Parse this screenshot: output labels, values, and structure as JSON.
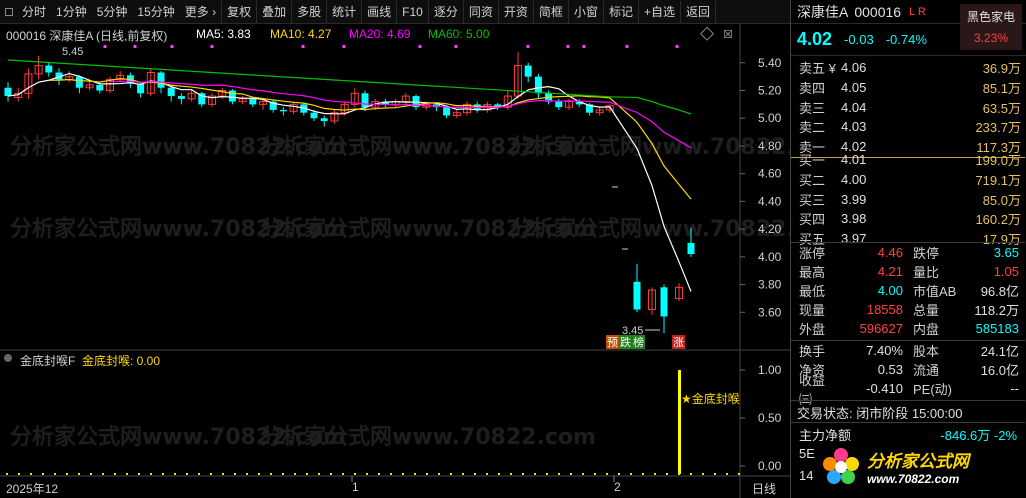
{
  "toolbar": {
    "items": [
      "分时",
      "1分钟",
      "5分钟",
      "15分钟",
      "更多 ›",
      "复权",
      "叠加",
      "多股",
      "统计",
      "画线",
      "F10",
      "逐分",
      "同资",
      "开资",
      "简框",
      "小窗",
      "标记",
      "+自选",
      "返回"
    ]
  },
  "main_header": {
    "code_name": "000016 深康佳A (日线,前复权)",
    "ma5": "MA5: 3.83",
    "ma10": "MA10: 4.27",
    "ma20": "MA20: 4.69",
    "ma60": "MA60: 5.00",
    "high_marker": "5.45",
    "low_marker": "3.45"
  },
  "badges": [
    "预",
    "跌",
    "榜",
    "涨"
  ],
  "sub_header": {
    "name": "金底封喉F",
    "value": "金底封喉: 0.00"
  },
  "signal_label": "★金底封喉",
  "x_axis": [
    "2025年12",
    "1",
    "2",
    "日线"
  ],
  "watermark": "分析家公式网www.70822.com",
  "colors": {
    "up": "#ff3c3c",
    "down": "#00ffff",
    "ma5": "#ffffff",
    "ma10": "#ffd700",
    "ma20": "#ff00ff",
    "ma60": "#00c000"
  },
  "chart_data": {
    "type": "candlestick",
    "ylim": [
      3.4,
      5.55
    ],
    "y_ticks": [
      5.4,
      5.2,
      5.0,
      4.8,
      4.6,
      4.4,
      4.2,
      4.0,
      3.8,
      3.6
    ],
    "sub_y_ticks": [
      1.0,
      0.5,
      0.0
    ],
    "candles": [
      [
        5.22,
        5.16,
        5.26,
        5.12
      ],
      [
        5.15,
        5.18,
        5.22,
        5.12
      ],
      [
        5.18,
        5.32,
        5.36,
        5.14
      ],
      [
        5.32,
        5.38,
        5.45,
        5.28
      ],
      [
        5.38,
        5.33,
        5.4,
        5.3
      ],
      [
        5.33,
        5.28,
        5.36,
        5.24
      ],
      [
        5.28,
        5.3,
        5.34,
        5.26
      ],
      [
        5.3,
        5.22,
        5.31,
        5.18
      ],
      [
        5.22,
        5.24,
        5.28,
        5.2
      ],
      [
        5.24,
        5.2,
        5.26,
        5.18
      ],
      [
        5.2,
        5.28,
        5.3,
        5.18
      ],
      [
        5.28,
        5.31,
        5.34,
        5.26
      ],
      [
        5.31,
        5.25,
        5.33,
        5.22
      ],
      [
        5.25,
        5.18,
        5.26,
        5.15
      ],
      [
        5.18,
        5.33,
        5.36,
        5.16
      ],
      [
        5.33,
        5.22,
        5.34,
        5.18
      ],
      [
        5.22,
        5.16,
        5.24,
        5.12
      ],
      [
        5.16,
        5.14,
        5.18,
        5.1
      ],
      [
        5.14,
        5.18,
        5.2,
        5.12
      ],
      [
        5.18,
        5.1,
        5.19,
        5.08
      ],
      [
        5.1,
        5.16,
        5.18,
        5.08
      ],
      [
        5.16,
        5.2,
        5.22,
        5.14
      ],
      [
        5.2,
        5.12,
        5.21,
        5.1
      ],
      [
        5.12,
        5.14,
        5.16,
        5.1
      ],
      [
        5.14,
        5.1,
        5.15,
        5.08
      ],
      [
        5.1,
        5.12,
        5.14,
        5.06
      ],
      [
        5.12,
        5.06,
        5.13,
        5.04
      ],
      [
        5.06,
        5.05,
        5.08,
        5.02
      ],
      [
        5.05,
        5.1,
        5.12,
        5.03
      ],
      [
        5.1,
        5.04,
        5.11,
        5.02
      ],
      [
        5.04,
        5.0,
        5.06,
        4.98
      ],
      [
        5.0,
        4.98,
        5.02,
        4.94
      ],
      [
        4.98,
        5.04,
        5.06,
        4.96
      ],
      [
        5.04,
        5.1,
        5.12,
        5.02
      ],
      [
        5.1,
        5.18,
        5.22,
        5.08
      ],
      [
        5.18,
        5.08,
        5.2,
        5.05
      ],
      [
        5.08,
        5.12,
        5.14,
        5.06
      ],
      [
        5.12,
        5.1,
        5.14,
        5.08
      ],
      [
        5.1,
        5.12,
        5.14,
        5.08
      ],
      [
        5.12,
        5.16,
        5.18,
        5.1
      ],
      [
        5.16,
        5.08,
        5.17,
        5.06
      ],
      [
        5.08,
        5.1,
        5.12,
        5.06
      ],
      [
        5.1,
        5.08,
        5.11,
        5.05
      ],
      [
        5.08,
        5.02,
        5.09,
        5.0
      ],
      [
        5.02,
        5.04,
        5.06,
        5.0
      ],
      [
        5.04,
        5.1,
        5.12,
        5.02
      ],
      [
        5.1,
        5.06,
        5.12,
        5.04
      ],
      [
        5.06,
        5.1,
        5.12,
        5.04
      ],
      [
        5.1,
        5.08,
        5.11,
        5.06
      ],
      [
        5.08,
        5.16,
        5.2,
        5.06
      ],
      [
        5.16,
        5.38,
        5.48,
        5.14
      ],
      [
        5.38,
        5.3,
        5.4,
        5.26
      ],
      [
        5.3,
        5.18,
        5.32,
        5.14
      ],
      [
        5.18,
        5.12,
        5.2,
        5.1
      ],
      [
        5.12,
        5.08,
        5.14,
        5.06
      ],
      [
        5.08,
        5.12,
        5.14,
        5.06
      ],
      [
        5.12,
        5.1,
        5.14,
        5.08
      ],
      [
        5.1,
        5.04,
        5.11,
        5.02
      ],
      [
        5.04,
        5.06,
        5.08,
        5.02
      ],
      [
        5.06,
        5.09,
        5.1,
        5.04
      ],
      [
        3.82,
        3.62,
        3.95,
        3.6
      ],
      [
        3.62,
        3.76,
        3.78,
        3.58
      ],
      [
        3.78,
        3.57,
        3.8,
        3.45
      ],
      [
        3.7,
        3.78,
        3.81,
        3.68
      ],
      [
        4.1,
        4.02,
        4.21,
        4.0
      ]
    ]
  },
  "panel": {
    "name": "深康佳A",
    "code": "000016",
    "lr": "L R",
    "sector": "黑色家电",
    "sector_change": "3.23%",
    "price": "4.02",
    "change": "-0.03",
    "change_pct": "-0.74%",
    "asks": [
      {
        "label": "卖五 ¥",
        "price": "4.06",
        "vol": "36.9万",
        "color": "red"
      },
      {
        "label": "卖四",
        "price": "4.05",
        "vol": "85.1万",
        "color": "white"
      },
      {
        "label": "卖三",
        "price": "4.04",
        "vol": "63.5万",
        "color": "cyan"
      },
      {
        "label": "卖二",
        "price": "4.03",
        "vol": "233.7万",
        "color": "cyan"
      },
      {
        "label": "卖一",
        "price": "4.02",
        "vol": "117.3万",
        "color": "cyan"
      }
    ],
    "bids": [
      {
        "label": "买一",
        "price": "4.01",
        "vol": "199.0万",
        "color": "cyan"
      },
      {
        "label": "买二",
        "price": "4.00",
        "vol": "719.1万",
        "color": "cyan"
      },
      {
        "label": "买三",
        "price": "3.99",
        "vol": "85.0万",
        "color": "cyan"
      },
      {
        "label": "买四",
        "price": "3.98",
        "vol": "160.2万",
        "color": "cyan"
      },
      {
        "label": "买五",
        "price": "3.97",
        "vol": "17.9万",
        "color": "cyan"
      }
    ],
    "stats_a": [
      {
        "k1": "涨停",
        "v1": "4.46",
        "c1": "red",
        "k2": "跌停",
        "v2": "3.65",
        "c2": "cyan"
      },
      {
        "k1": "最高",
        "v1": "4.21",
        "c1": "red",
        "k2": "量比",
        "v2": "1.05",
        "c2": "red"
      },
      {
        "k1": "最低",
        "v1": "4.00",
        "c1": "cyan",
        "k2": "市值AB",
        "v2": "96.8亿",
        "c2": "white"
      },
      {
        "k1": "现量",
        "v1": "18558",
        "c1": "red",
        "k2": "总量",
        "v2": "118.2万",
        "c2": "white"
      },
      {
        "k1": "外盘",
        "v1": "596627",
        "c1": "red",
        "k2": "内盘",
        "v2": "585183",
        "c2": "cyan"
      }
    ],
    "stats_b": [
      {
        "k1": "换手",
        "v1": "7.40%",
        "c1": "white",
        "k2": "股本",
        "v2": "24.1亿",
        "c2": "white"
      },
      {
        "k1": "净资",
        "v1": "0.53",
        "c1": "white",
        "k2": "流通",
        "v2": "16.0亿",
        "c2": "white"
      },
      {
        "k1": "收益㈢",
        "v1": "-0.410",
        "c1": "white",
        "k2": "PE(动)",
        "v2": "--",
        "c2": "white"
      }
    ],
    "trade_state": "交易状态: 闭市阶段 15:00:00",
    "mainflow_label": "主力净额",
    "mainflow_value": "-846.6万  -2%",
    "extra1": "5E",
    "extra2": "14",
    "logo_title": "分析家公式网",
    "logo_url": "www.70822.com"
  }
}
